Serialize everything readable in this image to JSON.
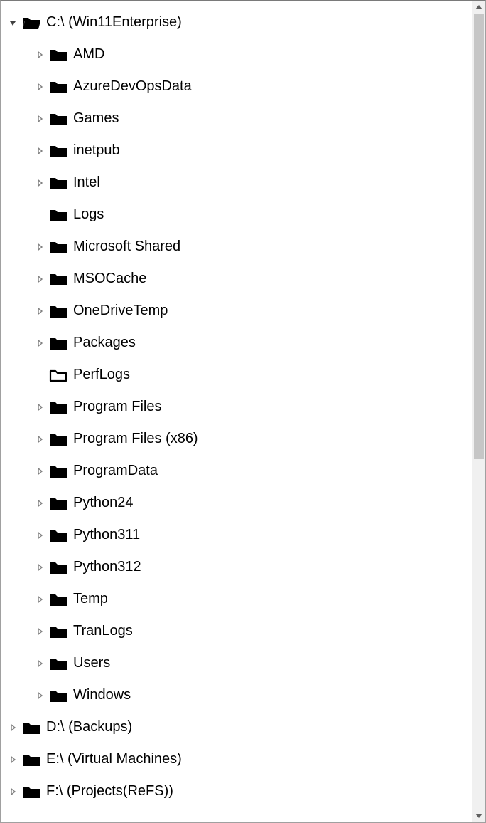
{
  "tree": {
    "root": {
      "label": "C:\\ (Win11Enterprise)",
      "children": [
        {
          "label": "AMD"
        },
        {
          "label": "AzureDevOpsData"
        },
        {
          "label": "Games"
        },
        {
          "label": "inetpub"
        },
        {
          "label": "Intel"
        },
        {
          "label": "Logs"
        },
        {
          "label": "Microsoft Shared"
        },
        {
          "label": "MSOCache"
        },
        {
          "label": "OneDriveTemp"
        },
        {
          "label": "Packages"
        },
        {
          "label": "PerfLogs"
        },
        {
          "label": "Program Files"
        },
        {
          "label": "Program Files (x86)"
        },
        {
          "label": "ProgramData"
        },
        {
          "label": "Python24"
        },
        {
          "label": "Python311"
        },
        {
          "label": "Python312"
        },
        {
          "label": "Temp"
        },
        {
          "label": "TranLogs"
        },
        {
          "label": "Users"
        },
        {
          "label": "Windows"
        }
      ]
    },
    "siblings": [
      {
        "label": "D:\\ (Backups)"
      },
      {
        "label": "E:\\ (Virtual Machines)"
      },
      {
        "label": "F:\\ (Projects(ReFS))"
      }
    ]
  }
}
